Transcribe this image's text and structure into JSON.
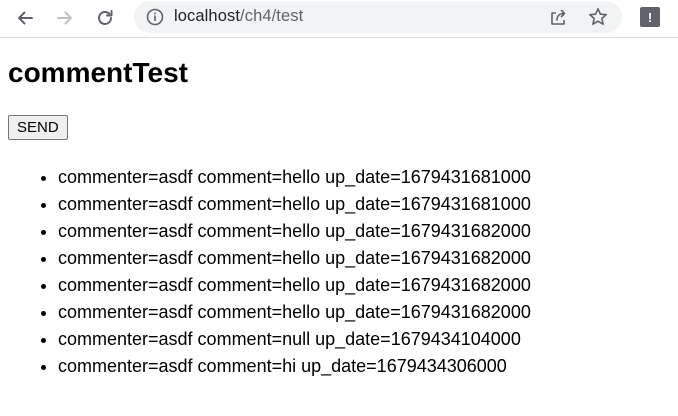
{
  "browser": {
    "url_host": "localhost",
    "url_path": "/ch4/test",
    "extension_label": "!"
  },
  "page": {
    "title": "commentTest",
    "send_button_label": "SEND",
    "comments": [
      "commenter=asdf comment=hello up_date=1679431681000",
      "commenter=asdf comment=hello up_date=1679431681000",
      "commenter=asdf comment=hello up_date=1679431682000",
      "commenter=asdf comment=hello up_date=1679431682000",
      "commenter=asdf comment=hello up_date=1679431682000",
      "commenter=asdf comment=hello up_date=1679431682000",
      "commenter=asdf comment=null up_date=1679434104000",
      "commenter=asdf comment=hi up_date=1679434306000"
    ]
  },
  "icons": {
    "back": "arrow-left-icon",
    "forward": "arrow-right-icon",
    "reload": "reload-icon",
    "info": "info-icon",
    "share": "share-icon",
    "bookmark": "star-icon",
    "extension": "extension-icon"
  }
}
